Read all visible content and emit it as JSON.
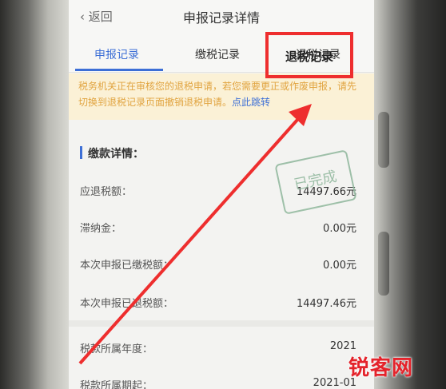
{
  "header": {
    "back_label": "返回",
    "title": "申报记录详情"
  },
  "tabs": [
    {
      "label": "申报记录",
      "active": true
    },
    {
      "label": "缴税记录",
      "active": false
    },
    {
      "label": "退税记录",
      "active": false
    }
  ],
  "notice": {
    "text": "税务机关正在审核您的退税申请，若您需要更正或作废申报，请先切换到退税记录页面撤销退税申请。",
    "link": "点此跳转"
  },
  "section": {
    "title": "缴款详情："
  },
  "rows": [
    {
      "label": "应退税额：",
      "value": "14497.66元"
    },
    {
      "label": "滞纳金：",
      "value": "0.00元"
    },
    {
      "label": "本次申报已缴税额：",
      "value": "0.00元"
    },
    {
      "label": "本次申报已退税额：",
      "value": "14497.46元"
    }
  ],
  "tax_rows": [
    {
      "label": "税款所属年度：",
      "value": "2021"
    },
    {
      "label": "税款所属期起：",
      "value": "2021-01"
    }
  ],
  "stamp": {
    "text": "已完成"
  },
  "callout": {
    "label": "退税记录"
  },
  "watermark": "锐客网",
  "colors": {
    "accent": "#3d6fd6",
    "annotation": "#ee2e2e",
    "notice_text": "#e1a440"
  }
}
